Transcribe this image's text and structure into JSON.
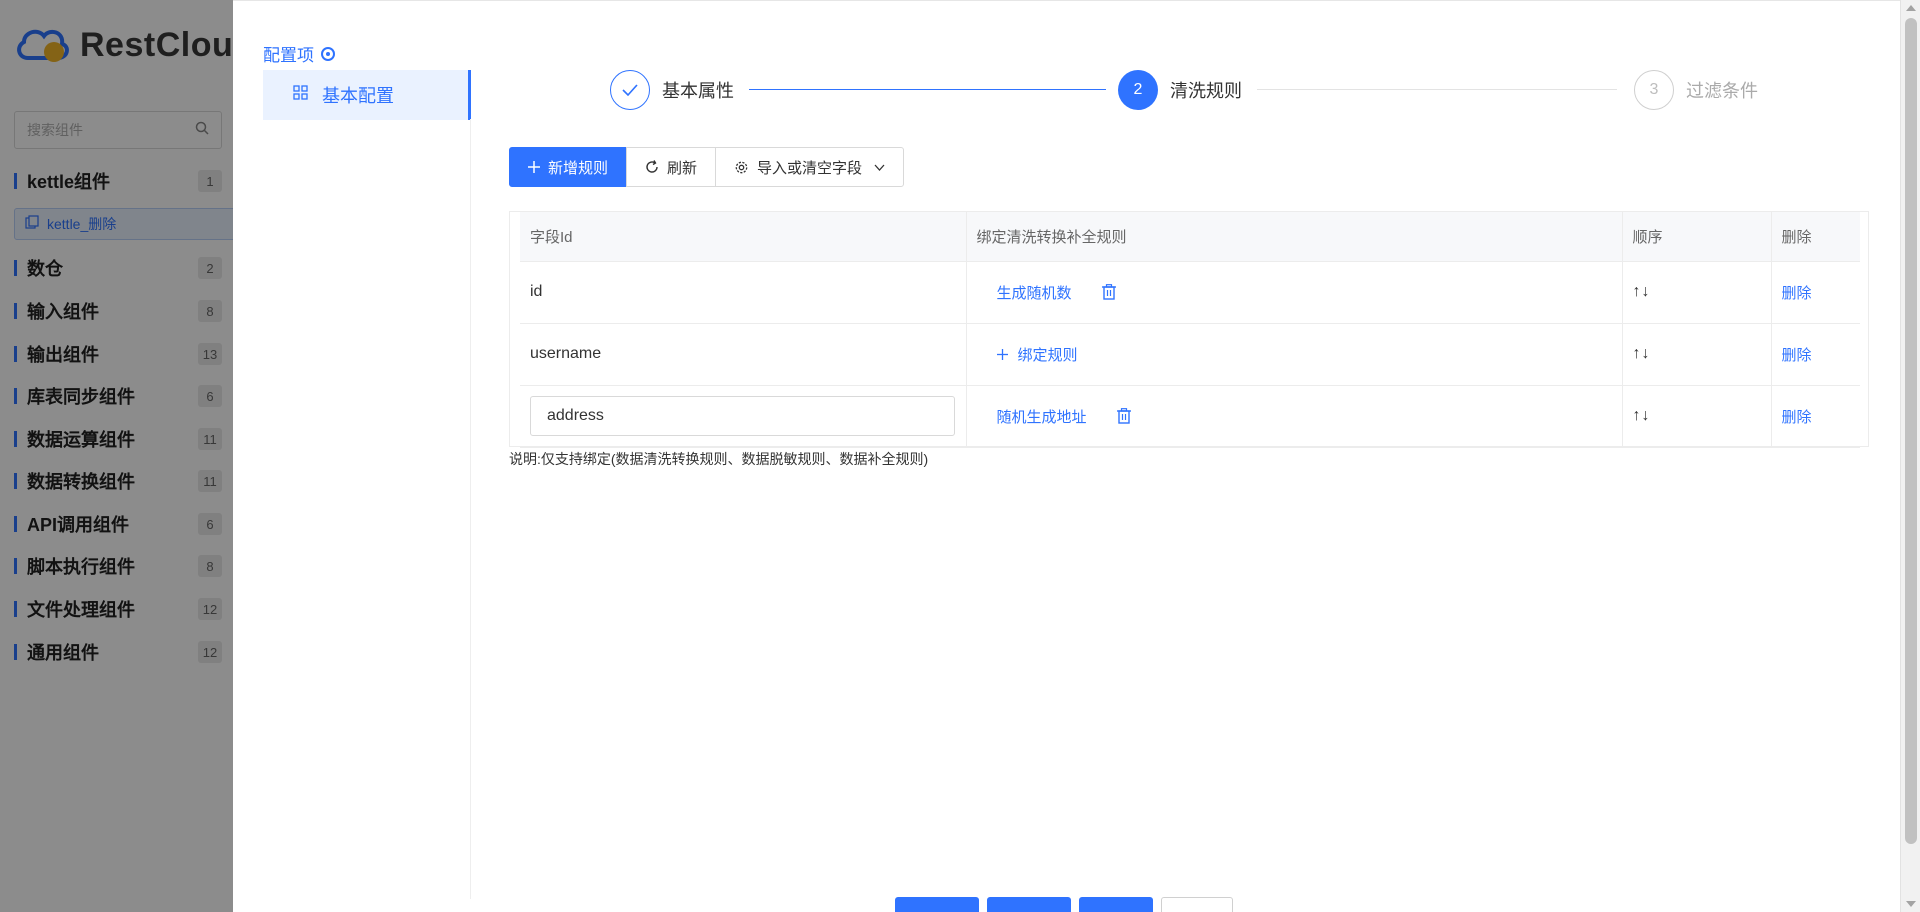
{
  "background_app": {
    "logo_text": "RestClou",
    "search_placeholder": "搜索组件",
    "sub_item": "kettle_删除",
    "categories": [
      {
        "label": "kettle组件",
        "count": "1"
      },
      {
        "label": "数仓",
        "count": "2"
      },
      {
        "label": "输入组件",
        "count": "8"
      },
      {
        "label": "输出组件",
        "count": "13"
      },
      {
        "label": "库表同步组件",
        "count": "6"
      },
      {
        "label": "数据运算组件",
        "count": "11"
      },
      {
        "label": "数据转换组件",
        "count": "11"
      },
      {
        "label": "API调用组件",
        "count": "6"
      },
      {
        "label": "脚本执行组件",
        "count": "8"
      },
      {
        "label": "文件处理组件",
        "count": "12"
      },
      {
        "label": "通用组件",
        "count": "12"
      }
    ]
  },
  "drawer": {
    "config_title": "配置项",
    "left_nav": [
      {
        "label": "基本配置"
      }
    ],
    "steps": [
      {
        "label": "基本属性",
        "state": "done",
        "number": ""
      },
      {
        "label": "清洗规则",
        "state": "active",
        "number": "2"
      },
      {
        "label": "过滤条件",
        "state": "pending",
        "number": "3"
      }
    ],
    "toolbar": {
      "add_label": "新增规则",
      "refresh_label": "刷新",
      "import_label": "导入或清空字段"
    },
    "table": {
      "headers": [
        "字段Id",
        "绑定清洗转换补全规则",
        "顺序",
        "删除"
      ],
      "rows": [
        {
          "field": "id",
          "editable": false,
          "rule": "生成随机数",
          "has_rule": true,
          "order": "↑↓",
          "delete": "删除"
        },
        {
          "field": "username",
          "editable": false,
          "rule": "绑定规则",
          "has_rule": false,
          "order": "↑↓",
          "delete": "删除"
        },
        {
          "field": "address",
          "editable": true,
          "rule": "随机生成地址",
          "has_rule": true,
          "order": "↑↓",
          "delete": "删除"
        }
      ]
    },
    "note": "说明:仅支持绑定(数据清洗转换规则、数据脱敏规则、数据补全规则)"
  },
  "colors": {
    "primary": "#2f73ff",
    "overlay": "rgba(0,0,0,0.45)"
  }
}
